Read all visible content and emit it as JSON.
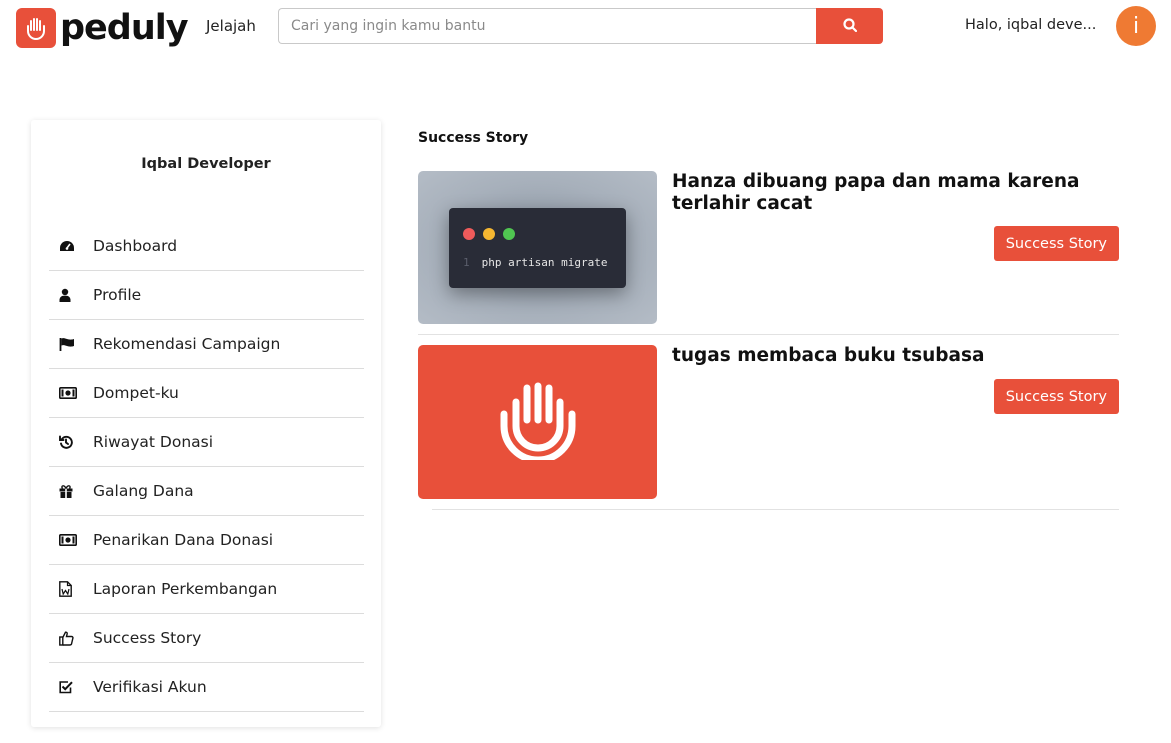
{
  "header": {
    "brand_name": "peduly",
    "explore_label": "Jelajah",
    "search_placeholder": "Cari yang ingin kamu bantu",
    "greeting": "Halo, iqbal deve...",
    "avatar_initial": "i",
    "accent_color": "#e8503a",
    "avatar_color": "#ef7a33"
  },
  "sidebar": {
    "user_name": "Iqbal Developer",
    "items": [
      {
        "label": "Dashboard",
        "icon": "dashboard-icon"
      },
      {
        "label": "Profile",
        "icon": "user-icon"
      },
      {
        "label": "Rekomendasi Campaign",
        "icon": "flag-icon"
      },
      {
        "label": "Dompet-ku",
        "icon": "money-icon"
      },
      {
        "label": "Riwayat Donasi",
        "icon": "history-icon"
      },
      {
        "label": "Galang Dana",
        "icon": "gift-icon"
      },
      {
        "label": " Penarikan Dana Donasi",
        "icon": "money-icon"
      },
      {
        "label": "Laporan Perkembangan",
        "icon": "document-icon"
      },
      {
        "label": "Success Story",
        "icon": "thumbs-up-icon"
      },
      {
        "label": "Verifikasi Akun",
        "icon": "check-square-icon"
      }
    ]
  },
  "main": {
    "section_title": "Success Story",
    "stories": [
      {
        "title": "Hanza dibuang papa dan mama karena terlahir cacat",
        "button_label": "Success Story",
        "thumbnail": {
          "line_number": "1",
          "code": "php artisan migrate"
        }
      },
      {
        "title": "tugas membaca buku tsubasa",
        "button_label": "Success Story",
        "thumbnail": {
          "icon": "hand-logo-icon"
        }
      }
    ]
  }
}
